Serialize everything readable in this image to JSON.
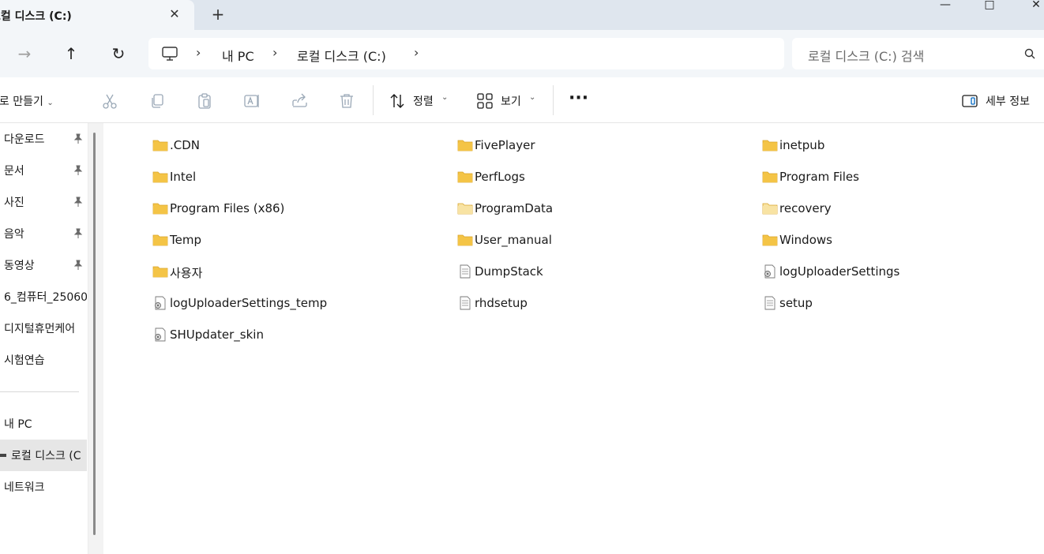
{
  "tab": {
    "title": "로컬 디스크 (C:)",
    "close": "✕",
    "new": "+"
  },
  "window": {
    "minimize": "—",
    "maximize": "□",
    "close": "✕"
  },
  "nav": {
    "forward": "→",
    "up": "↑",
    "refresh": "↻"
  },
  "breadcrumb": [
    "내 PC",
    "로컬 디스크 (C:)"
  ],
  "search": {
    "placeholder": "로컬 디스크 (C:) 검색"
  },
  "toolbar": {
    "new_label": "새로 만들기",
    "sort_label": "정렬",
    "view_label": "보기",
    "more_label": "···",
    "details_label": "세부 정보"
  },
  "sidebar": {
    "pinned": [
      {
        "label": "다운로드"
      },
      {
        "label": "문서"
      },
      {
        "label": "사진"
      },
      {
        "label": "음악"
      },
      {
        "label": "동영상"
      }
    ],
    "folders": [
      {
        "label": "6_컴퓨터_25060"
      },
      {
        "label": "디지털휴먼케어"
      },
      {
        "label": "시험연습"
      }
    ],
    "locations": [
      {
        "label": "내 PC"
      },
      {
        "label": "로컬 디스크 (C"
      },
      {
        "label": "네트워크"
      }
    ]
  },
  "files": [
    {
      "name": ".CDN",
      "type": "folder"
    },
    {
      "name": "FivePlayer",
      "type": "folder"
    },
    {
      "name": "inetpub",
      "type": "folder"
    },
    {
      "name": "Intel",
      "type": "folder"
    },
    {
      "name": "PerfLogs",
      "type": "folder"
    },
    {
      "name": "Program Files",
      "type": "folder"
    },
    {
      "name": "Program Files (x86)",
      "type": "folder"
    },
    {
      "name": "ProgramData",
      "type": "folder-light"
    },
    {
      "name": "recovery",
      "type": "folder-light"
    },
    {
      "name": "Temp",
      "type": "folder"
    },
    {
      "name": "User_manual",
      "type": "folder"
    },
    {
      "name": "Windows",
      "type": "folder"
    },
    {
      "name": "사용자",
      "type": "folder"
    },
    {
      "name": "DumpStack",
      "type": "text"
    },
    {
      "name": "logUploaderSettings",
      "type": "config"
    },
    {
      "name": "logUploaderSettings_temp",
      "type": "config"
    },
    {
      "name": "rhdsetup",
      "type": "text"
    },
    {
      "name": "setup",
      "type": "text"
    },
    {
      "name": "SHUpdater_skin",
      "type": "config"
    }
  ],
  "colors": {
    "folder": "#f4c446",
    "folder_light": "#f8e3a3",
    "accent": "#0067c0"
  }
}
